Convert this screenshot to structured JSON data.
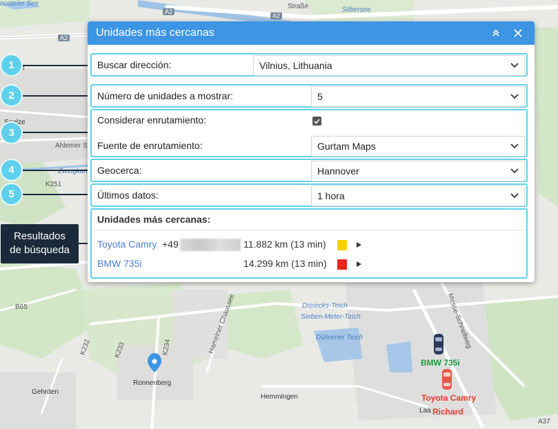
{
  "map": {
    "labels": {
      "top_left": "nosteler See",
      "silbersee": "Silbersee",
      "strasse": "Straße",
      "a2_left": "A2",
      "a2_right": "A2",
      "a2_mid": "A2",
      "left_n": "n",
      "seelze": "Seelze",
      "ahlemer": "Ahlemer Str",
      "zweigkanal": "Zweigkanal",
      "k251": "K251",
      "b65": "B65",
      "k232": "K232",
      "k233": "K233",
      "k234": "K234",
      "hamelner": "Hamelner Chaussee",
      "dreiecks": "Dreiecks-Teich",
      "sieben": "Sieben-Meter-Teich",
      "duhrener": "Dührener Teich",
      "messe": "Messe-Schnellweg",
      "ronnenberg": "Ronnenberg",
      "gehrden": "Gehrden",
      "hemmingen": "Hemmingen",
      "laa": "Laa",
      "a37": "A37"
    },
    "cars": {
      "bmw_label": "BMW 735i",
      "toyota_label": "Toyota Camry",
      "richard_label": "Richard"
    }
  },
  "panel": {
    "title": "Unidades más cercanas",
    "collapse_icon": "chevrons-up-icon",
    "close_icon": "close-icon",
    "search_address_label": "Buscar dirección:",
    "search_address_value": "Vilnius, Lithuania",
    "units_count_label": "Número de unidades a mostrar:",
    "units_count_value": "5",
    "consider_routing_label": "Considerar enrutamiento:",
    "consider_routing_checked": true,
    "routing_source_label": "Fuente de enrutamiento:",
    "routing_source_value": "Gurtam Maps",
    "geofence_label": "Geocerca:",
    "geofence_value": "Hannover",
    "last_data_label": "Últimos datos:",
    "last_data_value": "1 hora",
    "results_header": "Unidades más cercanas:",
    "results": [
      {
        "name": "Toyota Camry",
        "phone": "+49",
        "distance": "11.882 km (13 min)",
        "color": "#f6d000"
      },
      {
        "name": "BMW 735i",
        "phone": "",
        "distance": "14.299 km (13 min)",
        "color": "#e8261e"
      }
    ]
  },
  "callouts": {
    "c1": "1",
    "c2": "2",
    "c3": "3",
    "c4": "4",
    "c5": "5",
    "results_line1": "Resultados",
    "results_line2": "de búsqueda"
  },
  "colors": {
    "header_blue": "#3d95e4",
    "callout_cyan": "#5fd0ec",
    "link_blue": "#4a7fd4",
    "dark_navy": "#1b2a3a"
  }
}
